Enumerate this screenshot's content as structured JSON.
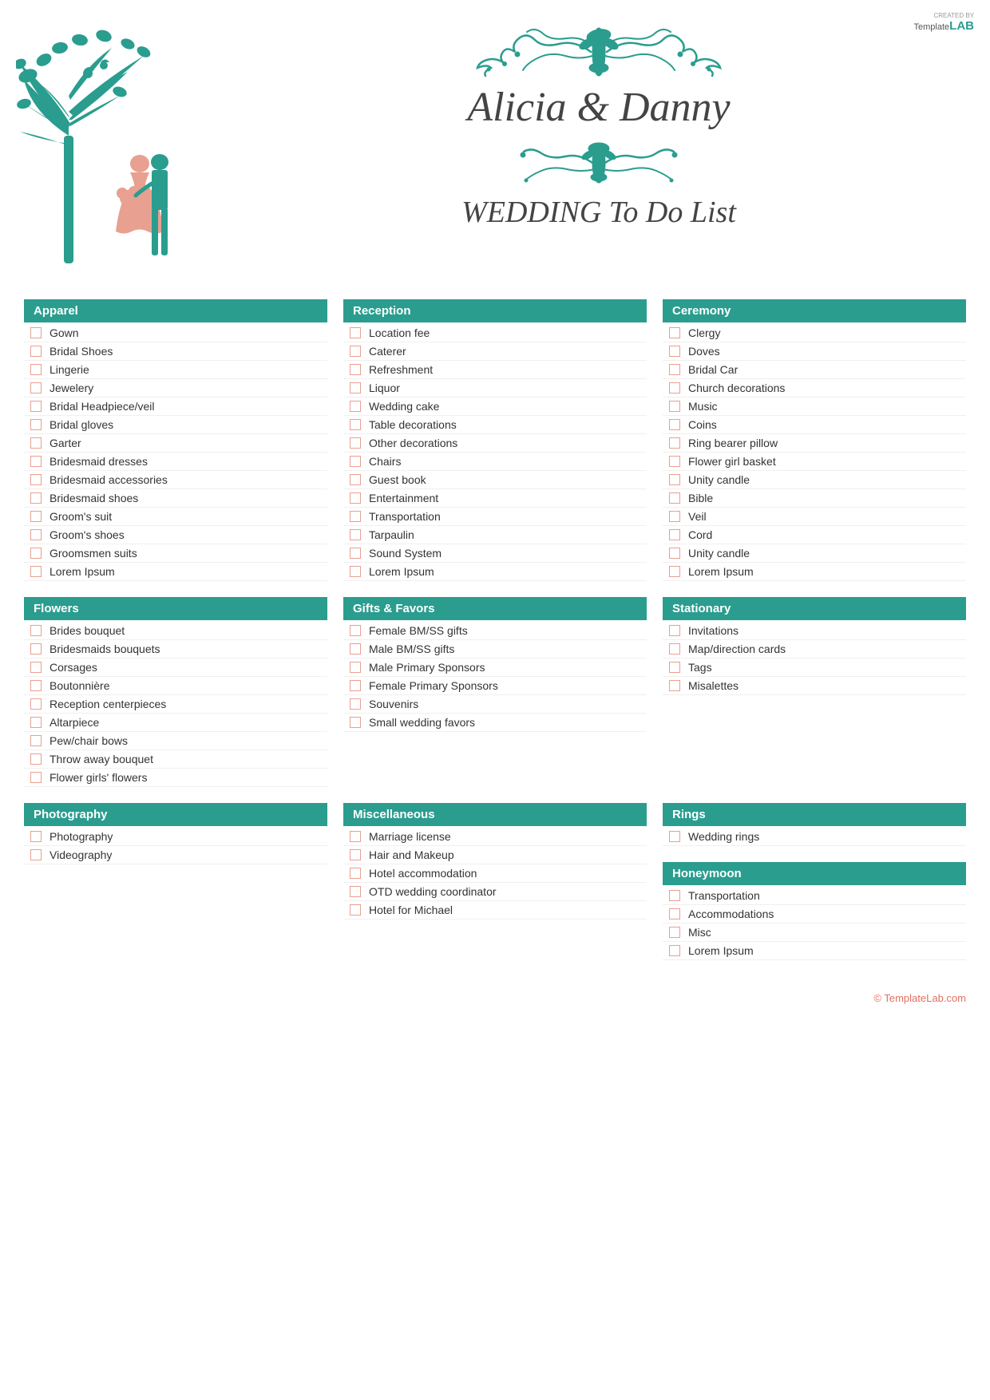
{
  "logo": {
    "created_by": "CREATED BY",
    "template": "Template",
    "lab": "LAB"
  },
  "header": {
    "couple_name": "Alicia & Danny",
    "page_title": "WEDDING To Do List"
  },
  "categories": [
    {
      "id": "apparel",
      "title": "Apparel",
      "items": [
        "Gown",
        "Bridal Shoes",
        "Lingerie",
        "Jewelery",
        "Bridal Headpiece/veil",
        "Bridal gloves",
        "Garter",
        "Bridesmaid dresses",
        "Bridesmaid accessories",
        "Bridesmaid shoes",
        "Groom's suit",
        "Groom's shoes",
        "Groomsmen suits",
        "Lorem Ipsum"
      ]
    },
    {
      "id": "reception",
      "title": "Reception",
      "items": [
        "Location fee",
        "Caterer",
        "Refreshment",
        "Liquor",
        "Wedding cake",
        "Table decorations",
        "Other decorations",
        "Chairs",
        "Guest book",
        "Entertainment",
        "Transportation",
        "Tarpaulin",
        "Sound System",
        "Lorem Ipsum"
      ]
    },
    {
      "id": "ceremony",
      "title": "Ceremony",
      "items": [
        "Clergy",
        "Doves",
        "Bridal Car",
        "Church decorations",
        "Music",
        "Coins",
        "Ring bearer pillow",
        "Flower girl basket",
        "Unity candle",
        "Bible",
        "Veil",
        "Cord",
        "Unity candle",
        "Lorem Ipsum"
      ]
    },
    {
      "id": "flowers",
      "title": "Flowers",
      "items": [
        "Brides bouquet",
        "Bridesmaids bouquets",
        "Corsages",
        "Boutonnière",
        "Reception centerpieces",
        "Altarpiece",
        "Pew/chair bows",
        "Throw away bouquet",
        "Flower girls' flowers"
      ]
    },
    {
      "id": "gifts-favors",
      "title": "Gifts & Favors",
      "items": [
        "Female BM/SS gifts",
        "Male BM/SS gifts",
        "Male Primary Sponsors",
        "Female Primary Sponsors",
        "Souvenirs",
        "Small wedding favors"
      ]
    },
    {
      "id": "stationary",
      "title": "Stationary",
      "items": [
        "Invitations",
        "Map/direction cards",
        "Tags",
        "Misalettes"
      ]
    },
    {
      "id": "photography",
      "title": "Photography",
      "items": [
        "Photography",
        "Videography"
      ]
    },
    {
      "id": "miscellaneous",
      "title": "Miscellaneous",
      "items": [
        "Marriage license",
        "Hair and Makeup",
        "Hotel accommodation",
        "OTD wedding coordinator",
        "Hotel for Michael"
      ]
    },
    {
      "id": "rings",
      "title": "Rings",
      "items": [
        "Wedding rings"
      ]
    },
    {
      "id": "honeymoon",
      "title": "Honeymoon",
      "items": [
        "Transportation",
        "Accommodations",
        "Misc",
        "Lorem Ipsum"
      ]
    }
  ],
  "footer": {
    "copyright": "© TemplateLab.com"
  }
}
